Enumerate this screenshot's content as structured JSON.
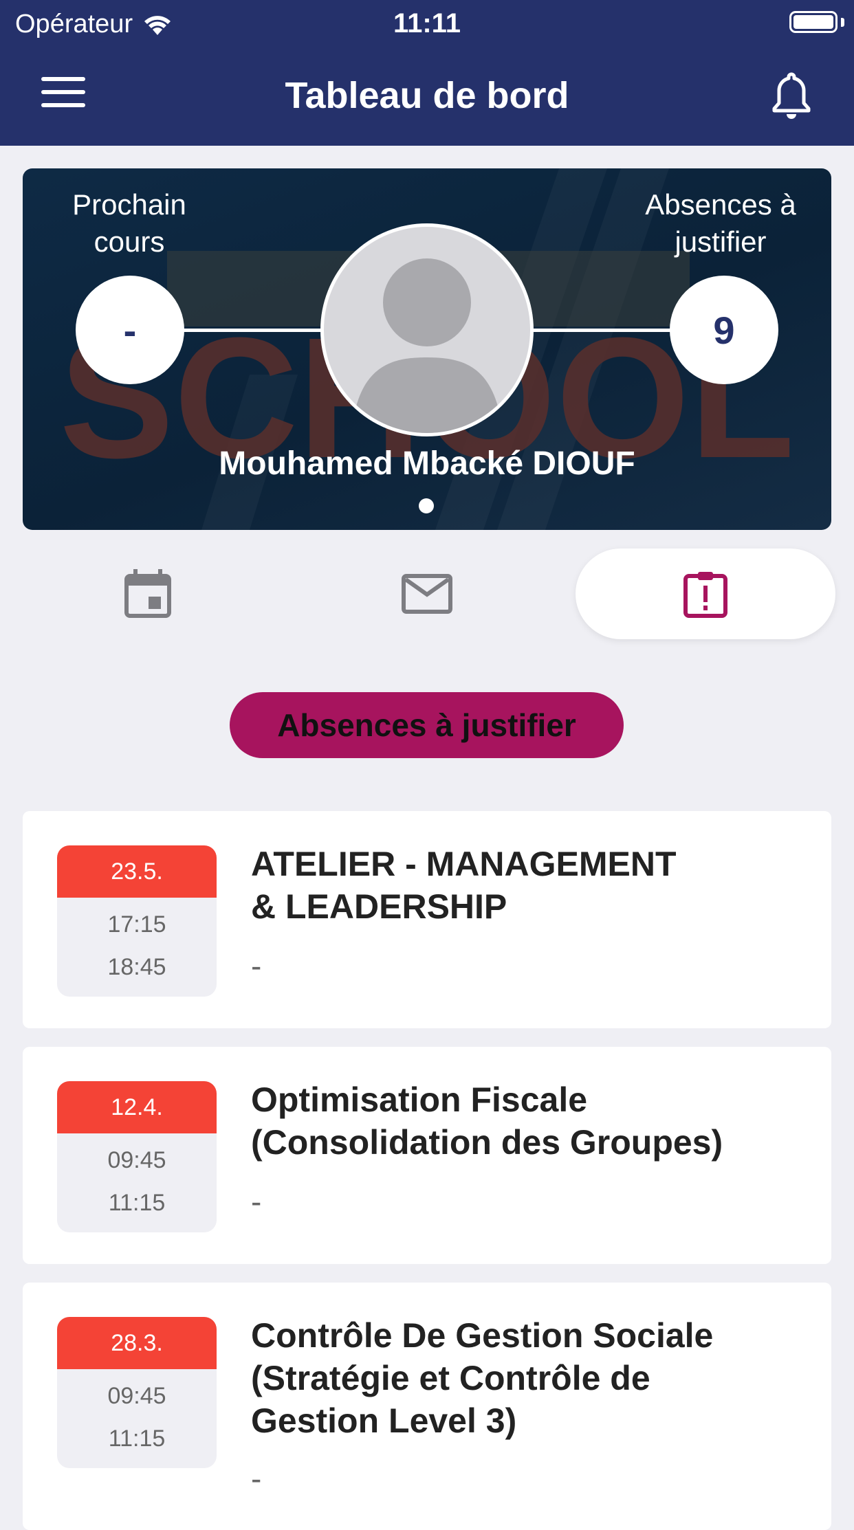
{
  "status_bar": {
    "carrier": "Opérateur",
    "time": "11:11"
  },
  "header": {
    "title": "Tableau de bord",
    "menu_icon": "hamburger-menu-icon",
    "bell_icon": "bell-icon"
  },
  "hero": {
    "left_label": "Prochain cours",
    "left_value": "-",
    "right_label": "Absences à justifier",
    "right_value": "9",
    "student_name": "Mouhamed Mbacké DIOUF"
  },
  "tabs": [
    {
      "icon": "calendar-icon",
      "selected": false
    },
    {
      "icon": "mail-icon",
      "selected": false
    },
    {
      "icon": "clipboard-alert-icon",
      "selected": true
    }
  ],
  "section_title": "Absences à justifier",
  "absences": [
    {
      "date": "23.5.",
      "start": "17:15",
      "end": "18:45",
      "title_lines": [
        "ATELIER - MANAGEMENT",
        "& LEADERSHIP"
      ],
      "subtitle": "-"
    },
    {
      "date": "12.4.",
      "start": "09:45",
      "end": "11:15",
      "title_lines": [
        "Optimisation Fiscale",
        "(Consolidation des Groupes)"
      ],
      "subtitle": "-"
    },
    {
      "date": "28.3.",
      "start": "09:45",
      "end": "11:15",
      "title_lines": [
        "Contrôle De Gestion Sociale",
        "(Stratégie et Contrôle de",
        "Gestion Level 3)"
      ],
      "subtitle": "-"
    }
  ],
  "colors": {
    "header_bg": "#25316b",
    "accent": "#a7145e",
    "date_red": "#f44336",
    "page_bg": "#efeff4"
  }
}
